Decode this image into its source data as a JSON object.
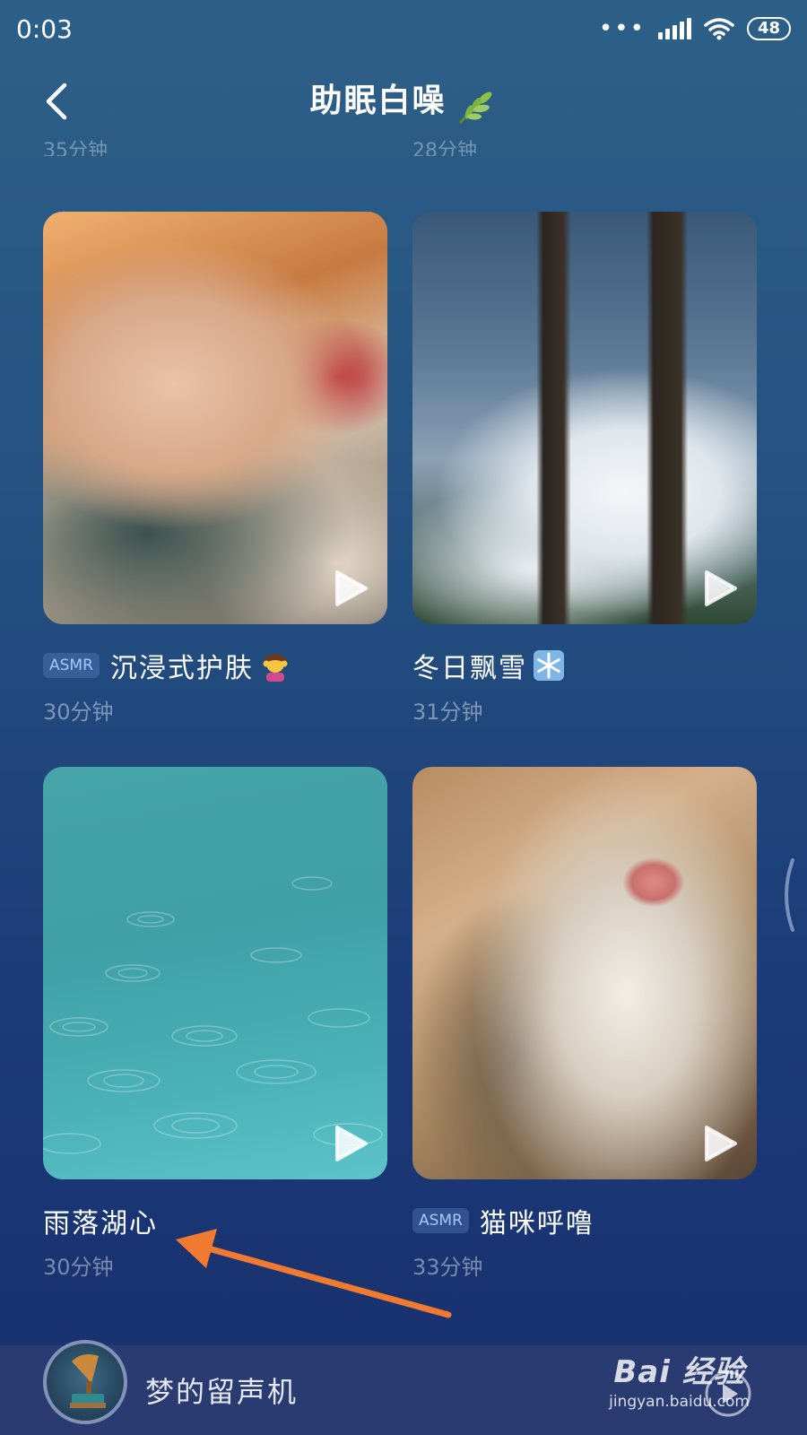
{
  "status_bar": {
    "time": "0:03",
    "battery": "48"
  },
  "header": {
    "title": "助眠白噪",
    "title_icon": "leaf-icon"
  },
  "partial_row": {
    "left_duration": "35分钟",
    "right_duration": "28分钟"
  },
  "cards": [
    {
      "badge": "ASMR",
      "title": "沉浸式护肤",
      "emoji": "facial-massage-icon",
      "duration": "30分钟",
      "image": "facial-massage"
    },
    {
      "badge": "",
      "title": "冬日飘雪",
      "emoji": "snowflake-icon",
      "duration": "31分钟",
      "image": "snowy-forest"
    },
    {
      "badge": "",
      "title": "雨落湖心",
      "emoji": "",
      "duration": "30分钟",
      "image": "rain-on-lake"
    },
    {
      "badge": "ASMR",
      "title": "猫咪呼噜",
      "emoji": "",
      "duration": "33分钟",
      "image": "sleeping-cat"
    }
  ],
  "player": {
    "title": "梦的留声机"
  },
  "watermark": {
    "main": "Bai 经验",
    "sub": "jingyan.baidu.com"
  },
  "colors": {
    "annotation_arrow": "#f07a2f",
    "background_top": "#2d6088",
    "background_bottom": "#18306e"
  }
}
